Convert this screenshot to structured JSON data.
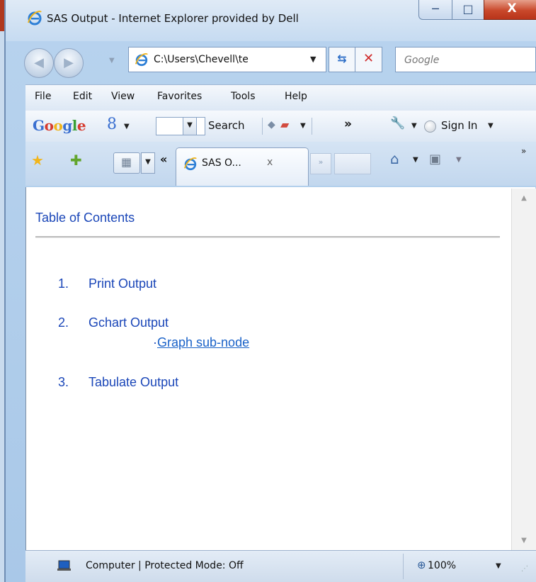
{
  "window": {
    "title": "SAS Output - Internet Explorer provided by Dell",
    "min_glyph": "─",
    "max_glyph": "□",
    "close_glyph": "X"
  },
  "address_bar": {
    "url": "C:\\Users\\Chevell\\te",
    "search_placeholder": "Google"
  },
  "menu": [
    "File",
    "Edit",
    "View",
    "Favorites",
    "Tools",
    "Help"
  ],
  "google_toolbar": {
    "logo": "Google",
    "search_label": "Search",
    "more_label": "»",
    "sign_in_label": "Sign In"
  },
  "tabs": {
    "active_title": "SAS O...",
    "close_glyph": "x",
    "scroll_left": "«",
    "more_glyph": "»",
    "overflow_chevron": "»"
  },
  "content": {
    "toc_title": "Table of Contents",
    "items": [
      {
        "num": "1.",
        "label": "Print Output"
      },
      {
        "num": "2.",
        "label": "Gchart Output"
      },
      {
        "num": "3.",
        "label": "Tabulate Output"
      }
    ],
    "sub_bullet": "·",
    "sub_link": "Graph sub-node"
  },
  "status_bar": {
    "zone_text": "Computer | Protected Mode: Off",
    "zoom": "100%"
  },
  "colors": {
    "link_blue": "#1a46b8",
    "chrome_blue": "#c6dbf1",
    "close_red": "#c9482b"
  }
}
